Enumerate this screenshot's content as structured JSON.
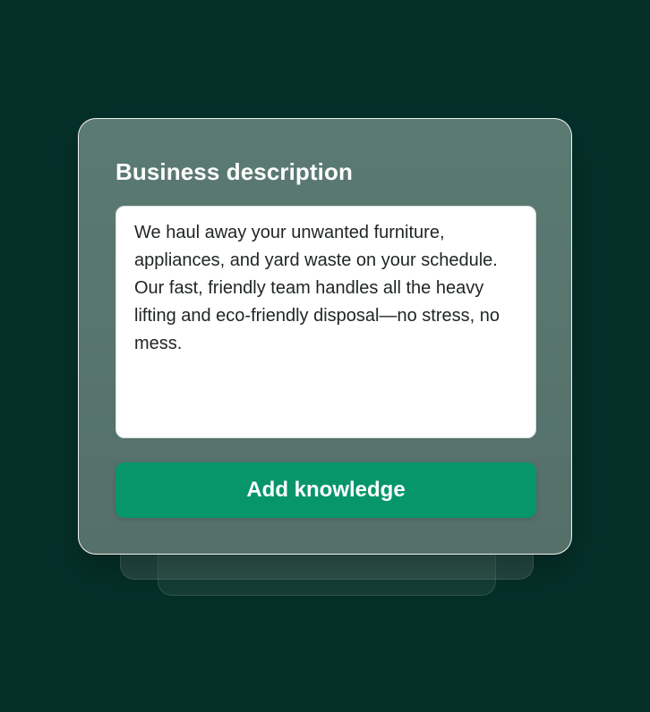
{
  "card": {
    "title": "Business description",
    "description": "We haul away your unwanted furniture, appliances, and yard waste on your schedule. Our fast, friendly team handles all the heavy lifting and eco-friendly disposal—no stress, no mess.",
    "button_label": "Add knowledge"
  },
  "colors": {
    "background": "#05302a",
    "card": "#587770",
    "button": "#07966a",
    "text_on_card": "#ffffff"
  }
}
